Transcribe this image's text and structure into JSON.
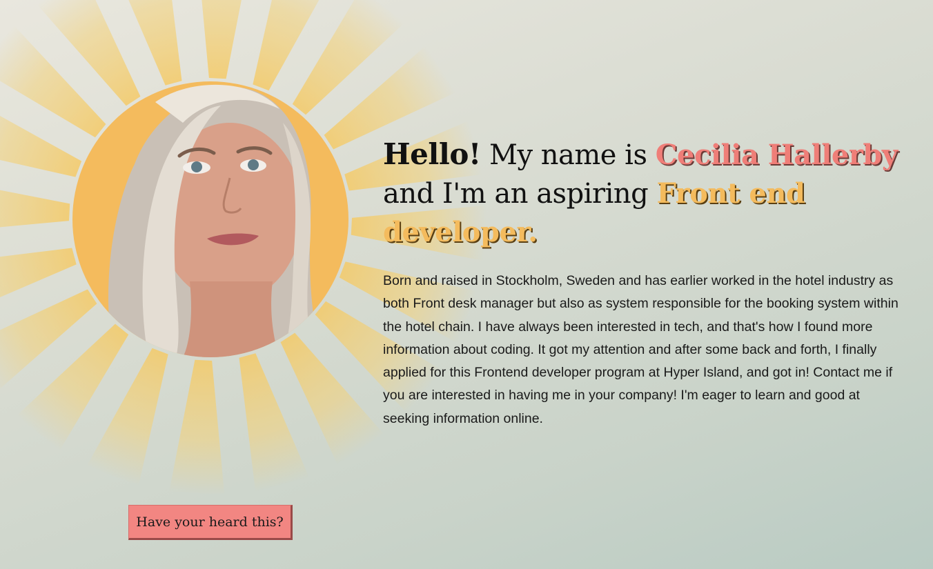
{
  "hero": {
    "headline": {
      "hello": "Hello!",
      "text1": " My name is ",
      "name": "Cecilia Hallerby",
      "text2": " and I'm an aspiring ",
      "role": "Front end developer."
    },
    "bio": "Born and raised in Stockholm, Sweden and has earlier worked in the hotel industry as both Front desk manager but also as system responsible for the booking system within the hotel chain. I have always been interested in tech, and that's how I found more information about coding. It got my attention and after some back and forth, I finally applied for this Frontend developer program at Hyper Island, and got in! Contact me if you are interested in having me in your company! I'm eager to learn and good at seeking information online.",
    "cta_label": "Have your heard this?"
  },
  "colors": {
    "name_accent": "#ef7e78",
    "role_accent": "#f4bb5d",
    "button": "#f28682",
    "sun": "#f4bb5d"
  }
}
